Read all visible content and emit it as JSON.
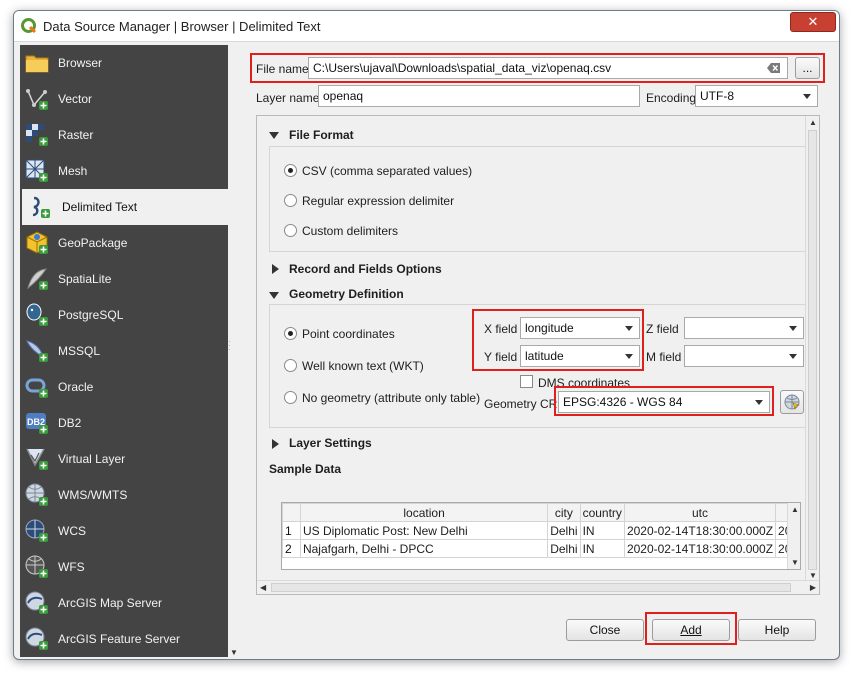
{
  "window": {
    "title": "Data Source Manager | Browser | Delimited Text",
    "close_glyph": "✕"
  },
  "sidebar": {
    "items": [
      {
        "label": "Browser",
        "icon": "folder-icon"
      },
      {
        "label": "Vector",
        "icon": "vector-icon"
      },
      {
        "label": "Raster",
        "icon": "raster-icon"
      },
      {
        "label": "Mesh",
        "icon": "mesh-icon"
      },
      {
        "label": "Delimited Text",
        "icon": "delimited-text-icon",
        "active": true
      },
      {
        "label": "GeoPackage",
        "icon": "geopackage-icon"
      },
      {
        "label": "SpatiaLite",
        "icon": "spatialite-icon"
      },
      {
        "label": "PostgreSQL",
        "icon": "postgresql-icon"
      },
      {
        "label": "MSSQL",
        "icon": "mssql-icon"
      },
      {
        "label": "Oracle",
        "icon": "oracle-icon"
      },
      {
        "label": "DB2",
        "icon": "db2-icon"
      },
      {
        "label": "Virtual Layer",
        "icon": "virtual-layer-icon"
      },
      {
        "label": "WMS/WMTS",
        "icon": "wms-icon"
      },
      {
        "label": "WCS",
        "icon": "wcs-icon"
      },
      {
        "label": "WFS",
        "icon": "wfs-icon"
      },
      {
        "label": "ArcGIS Map Server",
        "icon": "arcgis-map-server-icon"
      },
      {
        "label": "ArcGIS Feature Server",
        "icon": "arcgis-feature-server-icon"
      }
    ],
    "db2_badge": "DB2"
  },
  "file": {
    "label": "File name",
    "value": "C:\\Users\\ujaval\\Downloads\\spatial_data_viz\\openaq.csv",
    "browse_label": "..."
  },
  "layer": {
    "label": "Layer name",
    "value": "openaq"
  },
  "encoding": {
    "label": "Encoding",
    "value": "UTF-8"
  },
  "file_format": {
    "title": "File Format",
    "options": [
      {
        "label": "CSV (comma separated values)",
        "checked": true
      },
      {
        "label": "Regular expression delimiter",
        "checked": false
      },
      {
        "label": "Custom delimiters",
        "checked": false
      }
    ]
  },
  "record_fields": {
    "title": "Record and Fields Options"
  },
  "geometry": {
    "title": "Geometry Definition",
    "options": [
      {
        "label": "Point coordinates",
        "checked": true
      },
      {
        "label": "Well known text (WKT)",
        "checked": false
      },
      {
        "label": "No geometry (attribute only table)",
        "checked": false
      }
    ],
    "x_label": "X field",
    "x_value": "longitude",
    "y_label": "Y field",
    "y_value": "latitude",
    "z_label": "Z field",
    "z_value": "",
    "m_label": "M field",
    "m_value": "",
    "dms_label": "DMS coordinates",
    "crs_label": "Geometry CRS",
    "crs_value": "EPSG:4326 - WGS 84"
  },
  "layer_settings": {
    "title": "Layer Settings"
  },
  "sample": {
    "title": "Sample Data",
    "columns": [
      "",
      "location",
      "city",
      "country",
      "utc",
      ""
    ],
    "rows": [
      [
        "1",
        "US Diplomatic Post: New Delhi",
        "Delhi",
        "IN",
        "2020-02-14T18:30:00.000Z",
        "20"
      ],
      [
        "2",
        "Najafgarh, Delhi - DPCC",
        "Delhi",
        "IN",
        "2020-02-14T18:30:00.000Z",
        "20"
      ]
    ]
  },
  "buttons": {
    "close": "Close",
    "add": "Add",
    "help": "Help"
  },
  "colors": {
    "highlight": "#e0201c",
    "sidebar_bg": "#444444"
  }
}
